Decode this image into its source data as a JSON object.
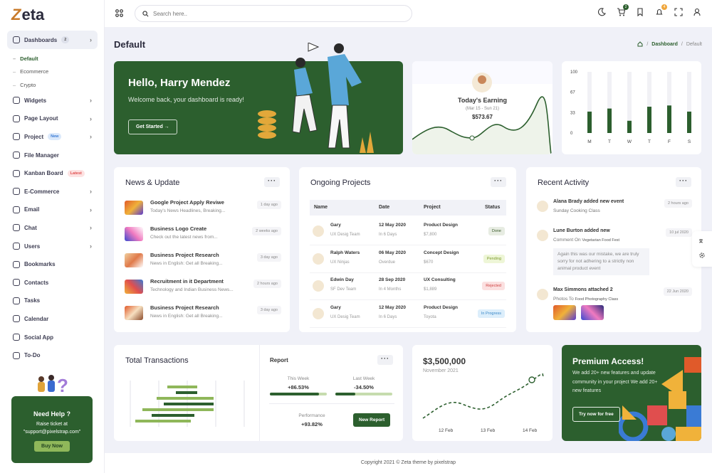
{
  "app": {
    "logo": "eta",
    "logo_initial": "Z"
  },
  "sidebar": {
    "items": [
      {
        "label": "Dashboards",
        "badge": "2",
        "badge_type": "count",
        "icon": "home-icon",
        "active": true
      },
      {
        "label": "Widgets",
        "icon": "widgets-icon",
        "chevron": true
      },
      {
        "label": "Page Layout",
        "icon": "layout-icon",
        "chevron": true
      },
      {
        "label": "Project",
        "badge": "New",
        "badge_type": "new",
        "icon": "project-icon",
        "chevron": true
      },
      {
        "label": "File Manager",
        "icon": "file-icon"
      },
      {
        "label": "Kanban Board",
        "badge": "Latest",
        "badge_type": "latest",
        "icon": "kanban-icon"
      },
      {
        "label": "E-Commerce",
        "icon": "bag-icon",
        "chevron": true
      },
      {
        "label": "Email",
        "icon": "mail-icon",
        "chevron": true
      },
      {
        "label": "Chat",
        "icon": "chat-icon",
        "chevron": true
      },
      {
        "label": "Users",
        "icon": "users-icon",
        "chevron": true
      },
      {
        "label": "Bookmarks",
        "icon": "bookmark-icon"
      },
      {
        "label": "Contacts",
        "icon": "contacts-icon"
      },
      {
        "label": "Tasks",
        "icon": "tasks-icon"
      },
      {
        "label": "Calendar",
        "icon": "calendar-icon"
      },
      {
        "label": "Social App",
        "icon": "social-icon"
      },
      {
        "label": "To-Do",
        "icon": "todo-icon"
      }
    ],
    "sub_items": [
      "Default",
      "Ecommerce",
      "Crypto"
    ],
    "help": {
      "title": "Need Help ?",
      "line1": "Raise ticket at",
      "line2": "\"support@pixelstrap.com\"",
      "button": "Buy Now"
    }
  },
  "topbar": {
    "search_placeholder": "Search here..",
    "cart_count": "2",
    "notif_count": "4"
  },
  "page": {
    "title": "Default",
    "breadcrumb": [
      "Dashboard",
      "Default"
    ]
  },
  "hello": {
    "title": "Hello, Harry Mendez",
    "subtitle": "Welcome back, your dashboard is ready!",
    "button": "Get Started"
  },
  "earning": {
    "title": "Today's Earning",
    "range": "(Mar 15 - Sun 21)",
    "amount": "$573.67"
  },
  "bar_chart": {
    "ticks": [
      "100",
      "67",
      "33",
      "0"
    ],
    "categories": [
      "M",
      "T",
      "W",
      "T",
      "F",
      "S"
    ],
    "values": [
      35,
      40,
      20,
      43,
      45,
      35
    ]
  },
  "news": {
    "title": "News & Update",
    "items": [
      {
        "title": "Google Project Apply Reviwe",
        "sub": "Today's News Headlines, Breaking...",
        "time": "1 day ago"
      },
      {
        "title": "Business Logo Create",
        "sub": "Check out the latest news from...",
        "time": "2 weeks ago"
      },
      {
        "title": "Business Project Research",
        "sub": "News in English: Get all Breaking...",
        "time": "3 day ago"
      },
      {
        "title": "Recruitment in it Department",
        "sub": "Technology and Indian Business News...",
        "time": "2 hours ago"
      },
      {
        "title": "Business Project Research",
        "sub": "News in English: Get all Breaking...",
        "time": "3 day ago"
      }
    ]
  },
  "projects": {
    "title": "Ongoing Projects",
    "headers": [
      "Name",
      "Date",
      "Project",
      "Status"
    ],
    "rows": [
      {
        "name": "Gary",
        "role": "UX Desig Team",
        "date": "12 May 2020",
        "dur": "In 6 Days",
        "project": "Product Design",
        "price": "$7,800",
        "status": "Done",
        "st": "done"
      },
      {
        "name": "Ralph Waters",
        "role": "UX Ninjas",
        "date": "06 May 2020",
        "dur": "Overdue",
        "project": "Concept Design",
        "price": "$670",
        "status": "Pending",
        "st": "pend"
      },
      {
        "name": "Edwin Day",
        "role": "SF Dev Team",
        "date": "28 Sep 2020",
        "dur": "In 4 Months",
        "project": "UX Consulting",
        "price": "$1,889",
        "status": "Rejected",
        "st": "rej"
      },
      {
        "name": "Gary",
        "role": "UX Desig Team",
        "date": "12 May 2020",
        "dur": "In 6 Days",
        "project": "Product Design",
        "price": "Toyota",
        "status": "In Progress",
        "st": "prog"
      }
    ]
  },
  "activity": {
    "title": "Recent Activity",
    "items": [
      {
        "title": "Alana Brady added new event",
        "sub": "Sunday Cooking Class",
        "time": "2 hours ago"
      },
      {
        "title": "Lune Burton added new",
        "sub": "Comment On",
        "sub_b": "Vegetarian Food Fest",
        "time": "10 jul 2020",
        "quote": "Again this was our mistake, we are truly sorry for not adhering to a strictly non animal product event"
      },
      {
        "title": "Max Simmons attached 2",
        "sub": "Photos To",
        "sub_b": "Food Photography Class",
        "time": "22 Jun 2020"
      }
    ]
  },
  "transactions": {
    "title": "Total Transactions",
    "report": "Report",
    "this_week_label": "This Week",
    "this_week": "+86.53%",
    "this_week_pct": 0.86,
    "last_week_label": "Last Week",
    "last_week": "-34.50%",
    "last_week_pct": 0.35,
    "perf_label": "Performance",
    "perf": "+93.82%",
    "button": "New Report"
  },
  "revenue": {
    "amount": "$3,500,000",
    "month": "November 2021",
    "x": [
      "12 Feb",
      "13 Feb",
      "14 Feb"
    ]
  },
  "premium": {
    "title": "Premium Access!",
    "text": "We add 20+ new features and update community in your project We add 20+ new features",
    "button": "Try now for free"
  },
  "footer": {
    "text": "Copyright 2021 © Zeta theme by pixelstrap"
  },
  "colors": {
    "primary": "#2c5f2e",
    "accent": "#8fb75a",
    "badge_orange": "#f0a63b"
  }
}
